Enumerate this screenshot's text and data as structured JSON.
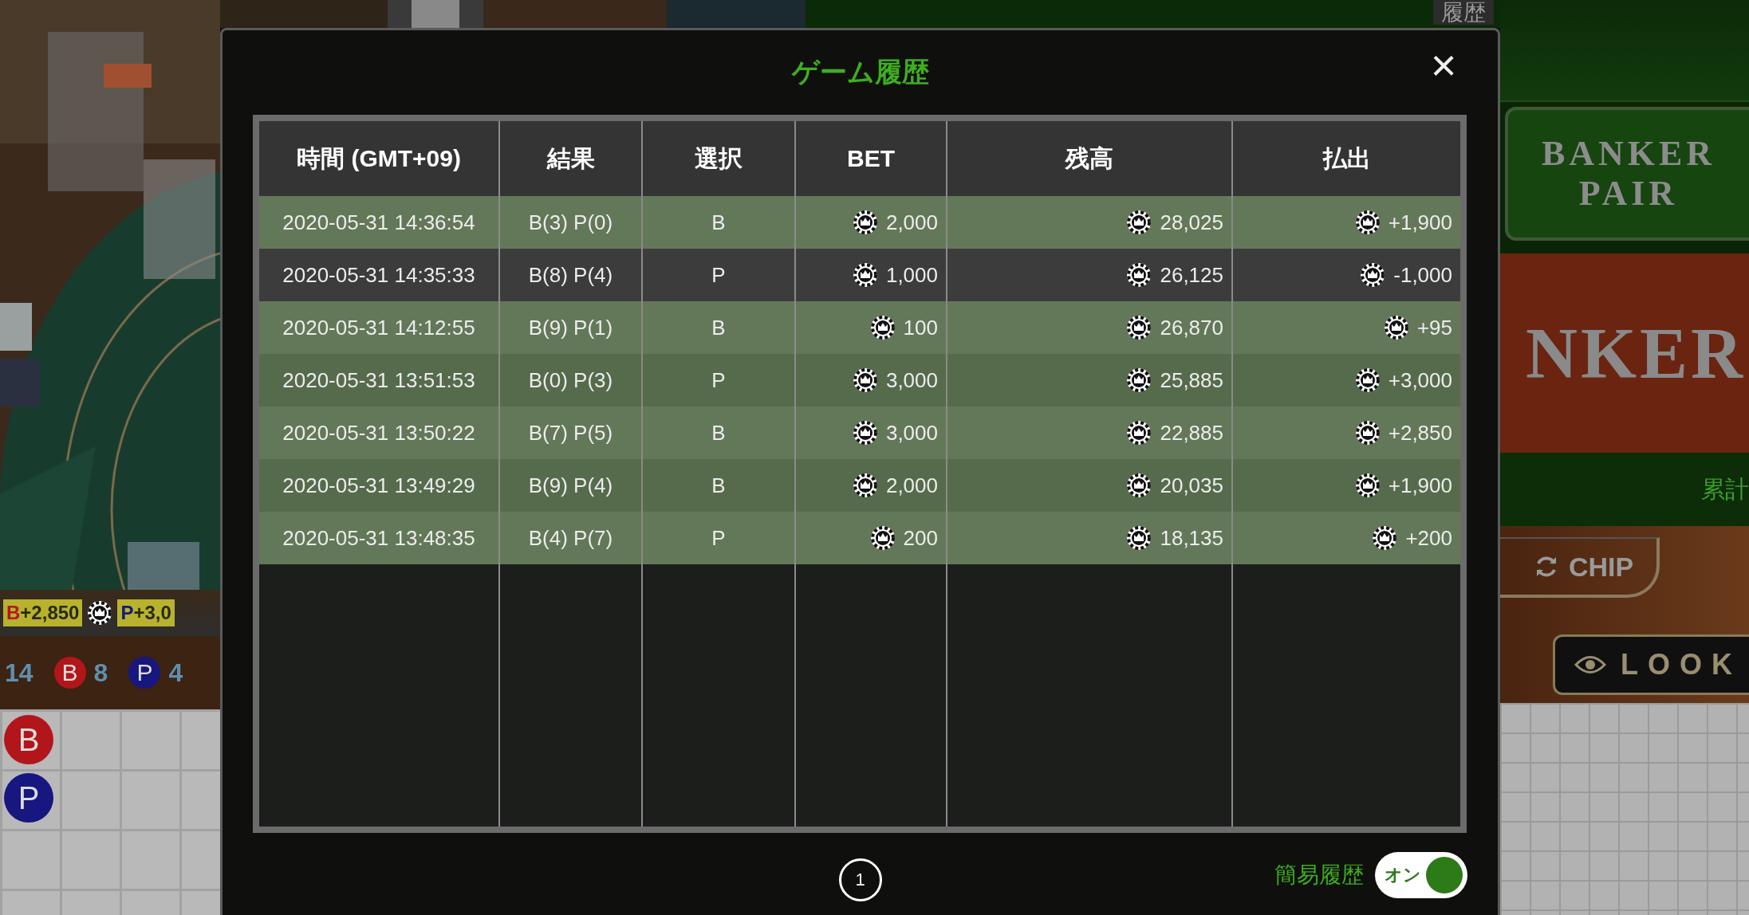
{
  "background": {
    "top_tab": "履歴",
    "result_strip": [
      {
        "side": "B",
        "amount": "+2,850"
      },
      {
        "side": "P",
        "amount": "+3,0"
      }
    ],
    "counts": {
      "total": "14",
      "sides": [
        {
          "color": "#b3161a",
          "letter": "B",
          "count": "8"
        },
        {
          "color": "#17177f",
          "letter": "P",
          "count": "4"
        }
      ]
    },
    "road": [
      {
        "color": "#b3161a",
        "letter": "B"
      },
      {
        "color": "#17177f",
        "letter": "P"
      }
    ],
    "banker_pair": "BANKER PAIR",
    "banker": "NKER",
    "cumulative": "累計",
    "chip_button": "CHIP",
    "look_button": "LOOK"
  },
  "dialog": {
    "title": "ゲーム履歴",
    "close": "×",
    "table": {
      "columns": [
        "時間 (GMT+09)",
        "結果",
        "選択",
        "BET",
        "残高",
        "払出"
      ],
      "rows": [
        {
          "time": "2020-05-31 14:36:54",
          "result": "B(3) P(0)",
          "choice": "B",
          "bet": "2,000",
          "balance": "28,025",
          "payout": "+1,900",
          "win": true
        },
        {
          "time": "2020-05-31 14:35:33",
          "result": "B(8) P(4)",
          "choice": "P",
          "bet": "1,000",
          "balance": "26,125",
          "payout": "-1,000",
          "win": false
        },
        {
          "time": "2020-05-31 14:12:55",
          "result": "B(9) P(1)",
          "choice": "B",
          "bet": "100",
          "balance": "26,870",
          "payout": "+95",
          "win": true
        },
        {
          "time": "2020-05-31 13:51:53",
          "result": "B(0) P(3)",
          "choice": "P",
          "bet": "3,000",
          "balance": "25,885",
          "payout": "+3,000",
          "win": true
        },
        {
          "time": "2020-05-31 13:50:22",
          "result": "B(7) P(5)",
          "choice": "B",
          "bet": "3,000",
          "balance": "22,885",
          "payout": "+2,850",
          "win": true
        },
        {
          "time": "2020-05-31 13:49:29",
          "result": "B(9) P(4)",
          "choice": "B",
          "bet": "2,000",
          "balance": "20,035",
          "payout": "+1,900",
          "win": true
        },
        {
          "time": "2020-05-31 13:48:35",
          "result": "B(4) P(7)",
          "choice": "P",
          "bet": "200",
          "balance": "18,135",
          "payout": "+200",
          "win": true
        }
      ]
    },
    "pages": [
      {
        "label": "1",
        "selected": true
      }
    ],
    "simple_history": {
      "label": "簡易履歴",
      "state_text": "オン",
      "on": true
    }
  }
}
